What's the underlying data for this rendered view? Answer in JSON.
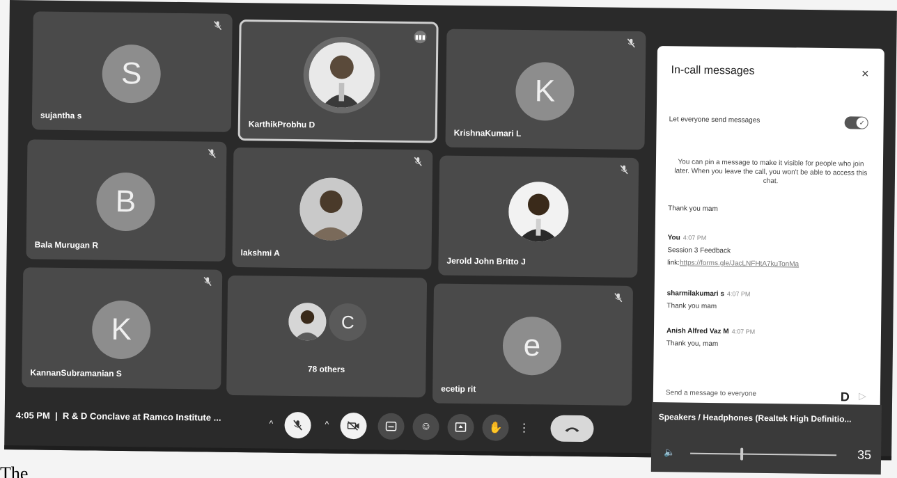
{
  "participants": [
    {
      "name": "sujantha s",
      "initial": "S",
      "muted": true
    },
    {
      "name": "KarthikProbhu D",
      "initial": "",
      "muted": false,
      "speaking": true
    },
    {
      "name": "KrishnaKumari L",
      "initial": "K",
      "muted": true
    },
    {
      "name": "Bala Murugan R",
      "initial": "B",
      "muted": true
    },
    {
      "name": "lakshmi A",
      "initial": "",
      "muted": true
    },
    {
      "name": "Jerold John Britto J",
      "initial": "",
      "muted": true
    },
    {
      "name": "KannanSubramanian S",
      "initial": "K",
      "muted": true
    },
    {
      "name": "78 others",
      "initial": "C",
      "muted": false
    },
    {
      "name": "ecetip rit",
      "initial": "e",
      "muted": true
    }
  ],
  "chat": {
    "title": "In-call messages",
    "close": "×",
    "toggle_label": "Let everyone send messages",
    "info": "You can pin a message to make it visible for people who join later. When you leave the call, you won't be able to access this chat.",
    "messages": [
      {
        "sender": "",
        "time": "",
        "lines": [
          "Thank you mam"
        ]
      },
      {
        "sender": "You",
        "time": "4:07 PM",
        "lines": [
          "Session 3 Feedback"
        ],
        "link_prefix": "link:",
        "link": "https://forms.gle/JacLNFHtA7kuTonMa"
      },
      {
        "sender": "sharmilakumari s",
        "time": "4:07 PM",
        "lines": [
          "Thank you mam"
        ]
      },
      {
        "sender": "Anish Alfred Vaz M",
        "time": "4:07 PM",
        "lines": [
          "Thank you, mam"
        ]
      }
    ],
    "input_placeholder": "Send a message to everyone"
  },
  "meeting": {
    "time": "4:05 PM",
    "separator": "|",
    "title": "R & D Conclave at Ramco Institute ..."
  },
  "audio": {
    "device": "Speakers / Headphones (Realtek High Definitio...",
    "volume": 35,
    "volume_fraction": 0.35
  },
  "bottom_text": "The"
}
